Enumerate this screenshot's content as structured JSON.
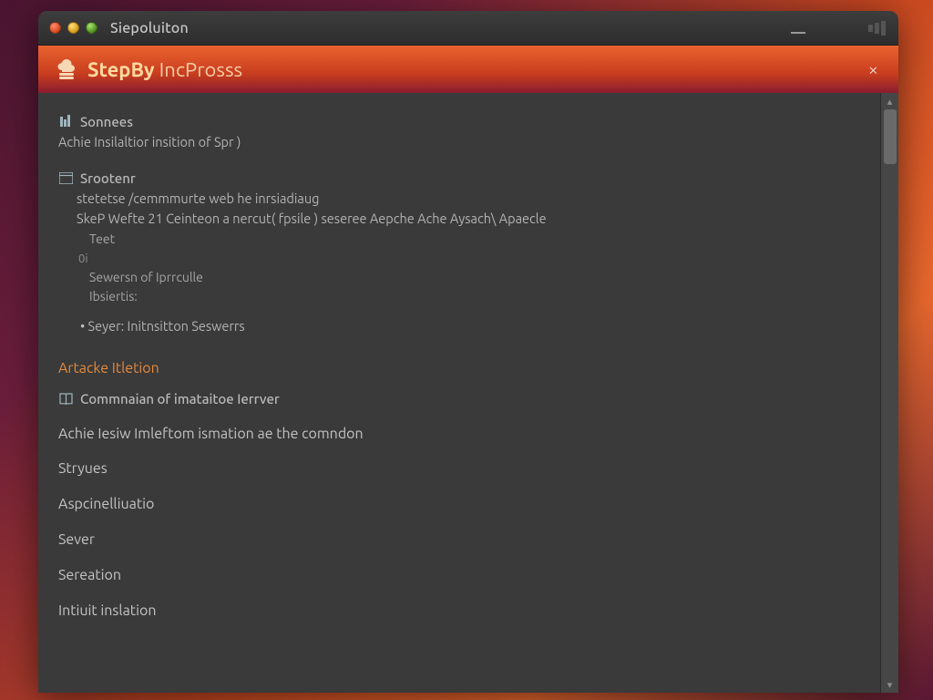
{
  "titlebar": {
    "title": "Siepoluiton"
  },
  "toolbar": {
    "brand_strong": "StepBy",
    "brand_sub": " IncProsss",
    "close_label": "×"
  },
  "content": {
    "sec1_title": "Sonnees",
    "sec1_line": "Achie Insilaltior insition of Spr )",
    "sec2_title": "Srootenr",
    "sec2_l1": "stetetse /cemmmurte web he inrsiadiaug",
    "sec2_l2": "SkeP Wefte 21 Ceinteon a nercut( fpsile ) seseree Aepche Ache Aysach\\ Apaecle",
    "sec2_l3": "Teet",
    "sec2_l4": "0i",
    "sec2_l5": "Sewersn of Iprrculle",
    "sec2_l6": "Ibsiertis:",
    "sec2_bullet": "Seyer: Initnsitton Seswerrs",
    "section_link": "Artacke Itletion",
    "sec3_title": "Commnaian of imataitoe Ierrver",
    "body1": "Achie Iesiw Imleftom ismation ae the comndon",
    "body2": "Stryues",
    "body3": "Aspcinelliuatio",
    "body4": "Sever",
    "body5": "Sereation",
    "body6": "Intiuit inslation"
  },
  "icons": {
    "sec1": "bars-icon",
    "sec2": "window-icon",
    "sec3": "book-icon",
    "brand": "cloud-stack-icon"
  }
}
